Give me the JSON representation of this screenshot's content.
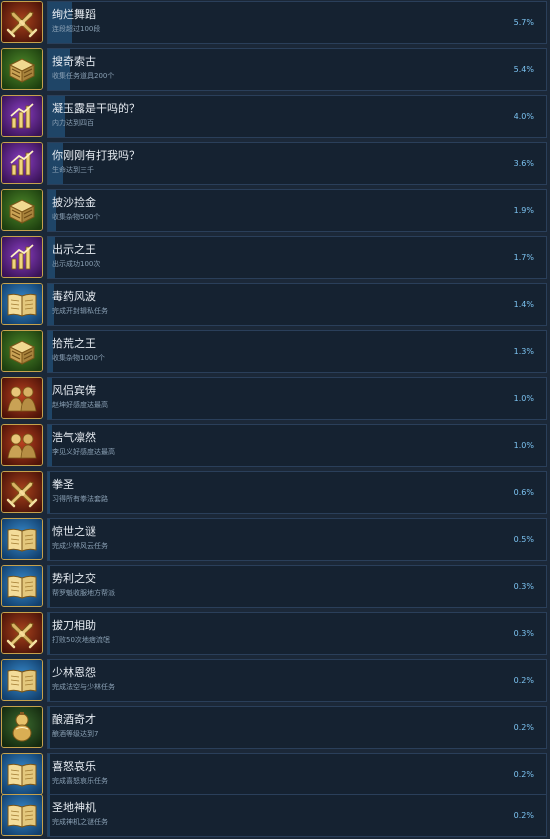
{
  "achievements": [
    {
      "icon": "crossed-swords-icon",
      "title": "绚烂舞蹈",
      "desc": "连段超过100段",
      "percent": "5.7%",
      "fraction": 0.057
    },
    {
      "icon": "treasure-chest-icon",
      "title": "搜奇索古",
      "desc": "收集任务道具200个",
      "percent": "5.4%",
      "fraction": 0.054
    },
    {
      "icon": "stat-bars-icon",
      "title": "凝玉露是干吗的？",
      "desc": "内力达到四百",
      "percent": "4.0%",
      "fraction": 0.04
    },
    {
      "icon": "stat-bars-icon",
      "title": "你刚刚有打我吗？",
      "desc": "生命达到三千",
      "percent": "3.6%",
      "fraction": 0.036
    },
    {
      "icon": "treasure-chest-icon",
      "title": "披沙捡金",
      "desc": "收集杂物500个",
      "percent": "1.9%",
      "fraction": 0.019
    },
    {
      "icon": "stat-bars-icon",
      "title": "出示之王",
      "desc": "出示成功100次",
      "percent": "1.7%",
      "fraction": 0.017
    },
    {
      "icon": "open-book-icon",
      "title": "毒药风波",
      "desc": "完成开封辑私任务",
      "percent": "1.4%",
      "fraction": 0.014
    },
    {
      "icon": "treasure-chest-icon",
      "title": "拾荒之王",
      "desc": "收集杂物1000个",
      "percent": "1.3%",
      "fraction": 0.013
    },
    {
      "icon": "companions-icon",
      "title": "风侣宾俦",
      "desc": "赵坤好感度达最高",
      "percent": "1.0%",
      "fraction": 0.01
    },
    {
      "icon": "companions-icon",
      "title": "浩气凛然",
      "desc": "李见义好感度达最高",
      "percent": "1.0%",
      "fraction": 0.01
    },
    {
      "icon": "crossed-swords-icon",
      "title": "拳圣",
      "desc": "习得所有拳法套路",
      "percent": "0.6%",
      "fraction": 0.006
    },
    {
      "icon": "open-book-icon",
      "title": "惊世之谜",
      "desc": "完成少林风云任务",
      "percent": "0.5%",
      "fraction": 0.005
    },
    {
      "icon": "open-book-icon",
      "title": "势利之交",
      "desc": "帮罗魁收服地方帮派",
      "percent": "0.3%",
      "fraction": 0.003
    },
    {
      "icon": "crossed-swords-icon",
      "title": "拔刀相助",
      "desc": "打败50次地痞流氓",
      "percent": "0.3%",
      "fraction": 0.003
    },
    {
      "icon": "open-book-icon",
      "title": "少林恩怨",
      "desc": "完成法空与少林任务",
      "percent": "0.2%",
      "fraction": 0.002
    },
    {
      "icon": "wine-gourd-icon",
      "title": "酿酒奇才",
      "desc": "酿酒等级达到7",
      "percent": "0.2%",
      "fraction": 0.002
    },
    {
      "icon": "open-book-icon",
      "title": "喜怒哀乐",
      "desc": "完成喜怒哀乐任务",
      "percent": "0.2%",
      "fraction": 0.002
    },
    {
      "icon": "open-book-icon",
      "title": "圣地神机",
      "desc": "完成神机之谜任务",
      "percent": "0.2%",
      "fraction": 0.002
    }
  ]
}
